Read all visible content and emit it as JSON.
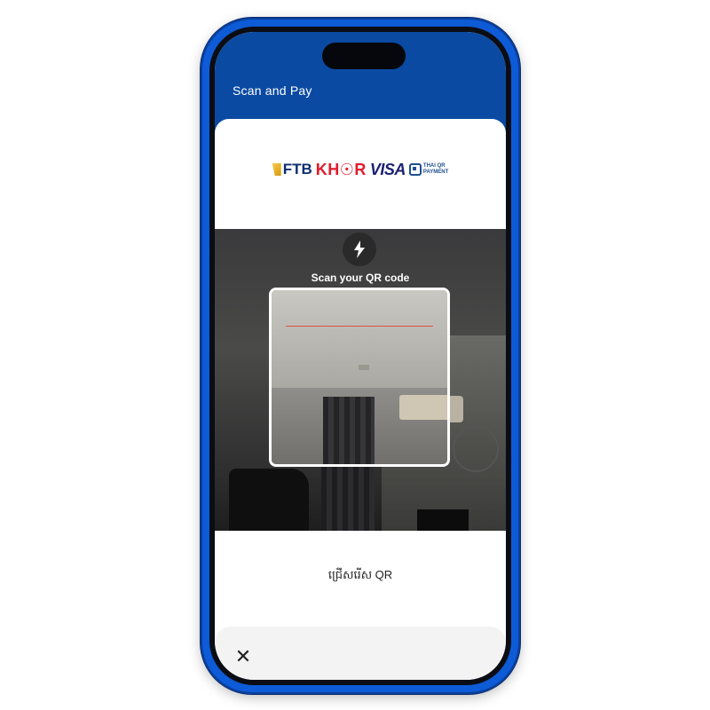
{
  "header": {
    "title": "Scan and Pay"
  },
  "logos": {
    "ftb": "FTB",
    "khqr": "KH☉R",
    "visa": "VISA",
    "thai_qr_line1": "THAI QR",
    "thai_qr_line2": "PAYMENT"
  },
  "scanner": {
    "flash_icon": "lightning-icon",
    "label": "Scan your QR code"
  },
  "select": {
    "label": "ជ្រើសរើស QR"
  },
  "bottom": {
    "close_icon": "close-icon"
  },
  "colors": {
    "header": "#0b4aa2",
    "phone_frame": "#0d5bd6",
    "scan_line": "#e05050"
  }
}
